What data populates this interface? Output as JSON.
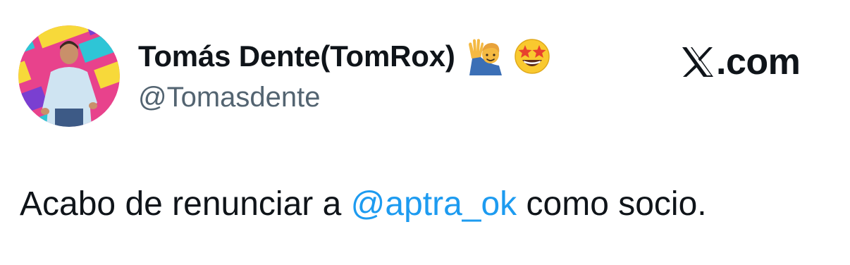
{
  "author": {
    "display_name": "Tomás Dente(TomRox)",
    "name_emojis": [
      "person-raising-hand-icon",
      "star-struck-icon"
    ],
    "handle": "@Tomasdente",
    "avatar": "avatar"
  },
  "brand": {
    "icon": "x-logo-icon",
    "text": ".com"
  },
  "tweet": {
    "text_before": "Acabo de renunciar a ",
    "mention": "@aptra_ok",
    "text_after": " como socio."
  },
  "colors": {
    "text": "#0f1419",
    "handle": "#536471",
    "mention": "#1d9bf0",
    "background": "#ffffff"
  }
}
